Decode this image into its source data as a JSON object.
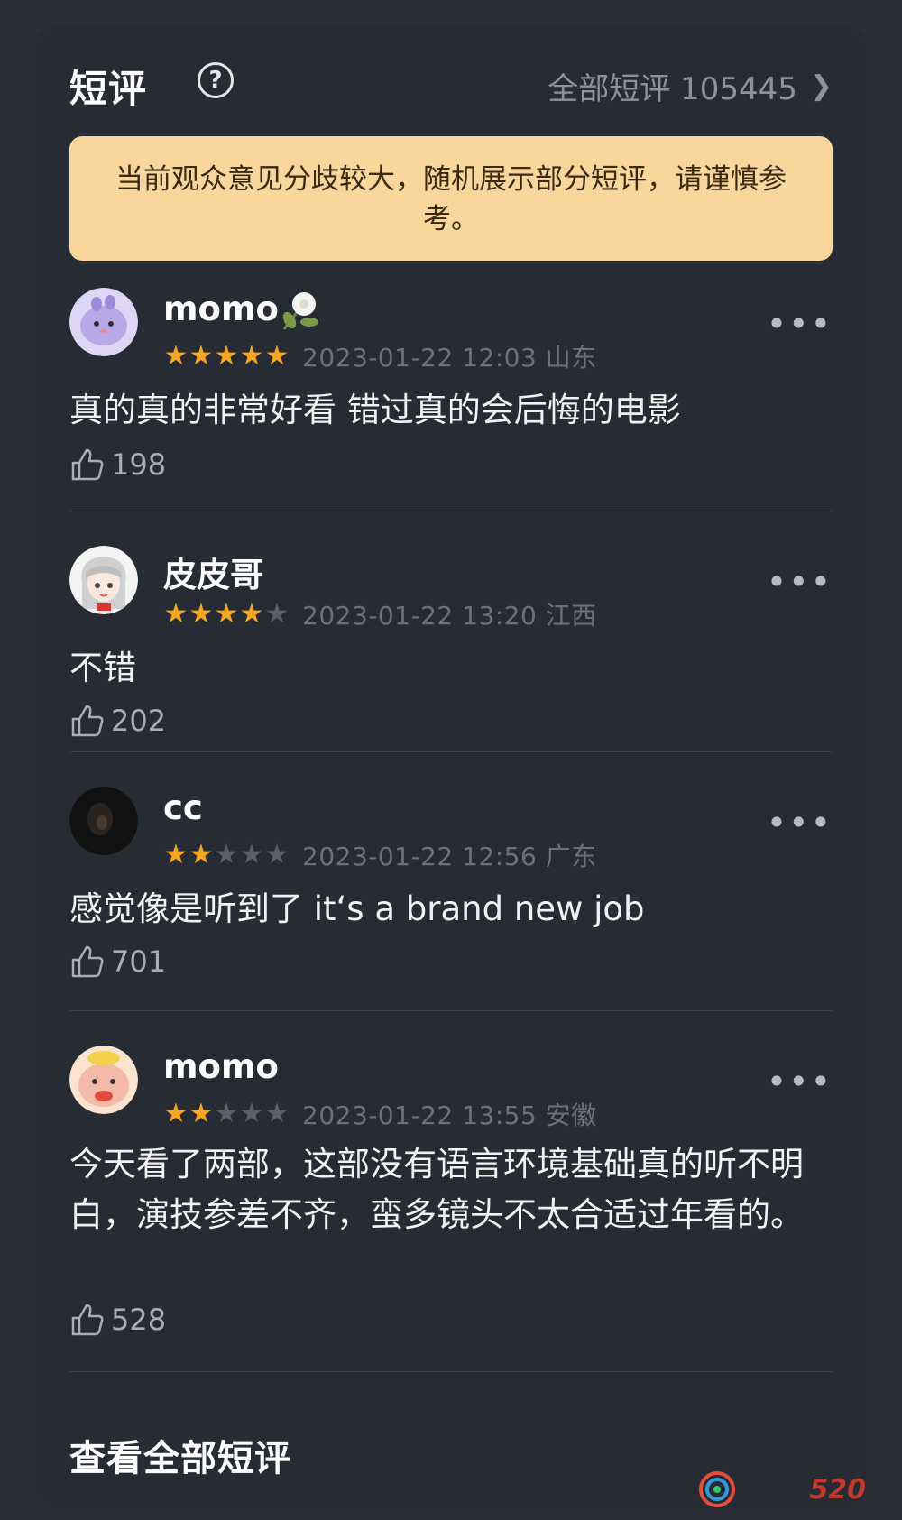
{
  "header": {
    "title": "短评",
    "help_icon": "question-circle-icon",
    "all_link_label": "全部短评 105445",
    "chevron_icon": "chevron-right-icon"
  },
  "notice": {
    "text": "当前观众意见分歧较大，随机展示部分短评，请谨慎参考。"
  },
  "reviews": [
    {
      "username": "momo",
      "avatar_icon": "purple-blob-avatar",
      "badge_icon": "flower-badge-icon",
      "rating": 5,
      "max_rating": 5,
      "time_location": "2023-01-22 12:03 山东",
      "content": "真的真的非常好看 错过真的会后悔的电影",
      "likes": "198"
    },
    {
      "username": "皮皮哥",
      "avatar_icon": "anime-girl-avatar",
      "rating": 4,
      "max_rating": 5,
      "time_location": "2023-01-22 13:20 江西",
      "content": "不错",
      "likes": "202"
    },
    {
      "username": "cc",
      "avatar_icon": "dark-photo-avatar",
      "rating": 2,
      "max_rating": 5,
      "time_location": "2023-01-22 12:56 广东",
      "content": "感觉像是听到了 it‘s a brand new job",
      "likes": "701"
    },
    {
      "username": "momo",
      "avatar_icon": "pink-blob-avatar",
      "rating": 2,
      "max_rating": 5,
      "time_location": "2023-01-22 13:55 安徽",
      "content": "今天看了两部，这部没有语言环境基础真的听不明白，演技参差不齐，蛮多镜头不太合适过年看的。",
      "likes": "528"
    }
  ],
  "footer": {
    "view_all_label": "查看全部短评"
  },
  "watermark": {
    "number": "520"
  },
  "colors": {
    "background": "#2b2e36",
    "card": "#272b33",
    "notice_bg": "#f8d69c",
    "star_on": "#f5a623",
    "star_off": "#5b5f66"
  }
}
